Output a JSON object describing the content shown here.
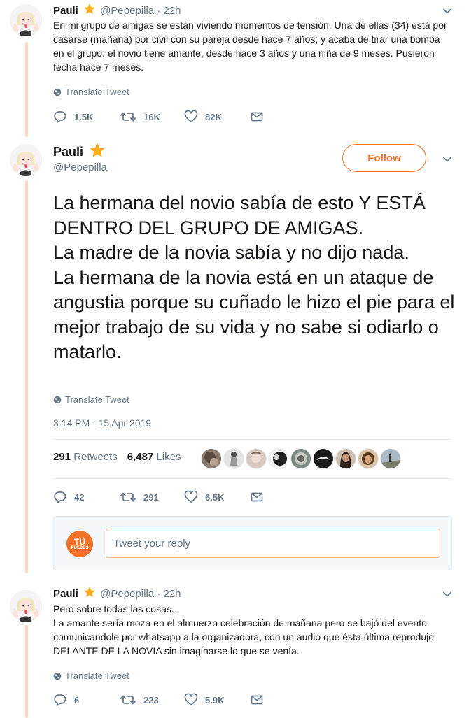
{
  "colors": {
    "accent": "#f0722a",
    "thread_line": "#ffd9c2",
    "star": "#ffad1f",
    "muted": "#657786",
    "text": "#14171a"
  },
  "tweet1": {
    "name": "Pauli",
    "handle_time": "@Pepepilla · 22h",
    "text": "En mi grupo de amigas se están viviendo momentos de tensión. Una de ellas (34) está por casarse (mañana) por civil con su pareja desde hace 7 años; y acaba de tirar una bomba en el grupo: el novio tiene amante, desde hace 3 años y una niña de 9 meses. Pusieron fecha hace 7 meses.",
    "translate": "Translate Tweet",
    "replies": "1.5K",
    "retweets": "16K",
    "likes": "82K"
  },
  "main_tweet": {
    "name": "Pauli",
    "handle": "@Pepepilla",
    "follow_label": "Follow",
    "text": "La hermana del novio sabía de esto Y ESTÁ DENTRO DEL GRUPO DE AMIGAS.\nLa madre de la novia sabía y no dijo nada.\nLa hermana de la novia está en un ataque de angustia porque su cuñado le hizo el pie para el mejor trabajo de su vida y no sabe si odiarlo o matarlo.",
    "translate": "Translate Tweet",
    "timestamp": "3:14 PM - 15 Apr 2019",
    "retweet_count": "291",
    "retweet_label": "Retweets",
    "like_count": "6,487",
    "like_label": "Likes",
    "replies": "42",
    "retweets": "291",
    "likes": "6.5K"
  },
  "reply_box": {
    "avatar_text": "TÚ",
    "avatar_sub": "PUEDES",
    "placeholder": "Tweet your reply"
  },
  "tweet3": {
    "name": "Pauli",
    "handle_time": "@Pepepilla · 22h",
    "text": "Pero sobre todas las cosas...\nLa amante sería moza en el almuerzo celebración de mañana pero se bajó del evento comunicandole por whatsapp a la organizadora, con un audio que ésta última reprodujo DELANTE DE LA NOVIA sin imaginarse lo que se venía.",
    "translate": "Translate Tweet",
    "replies": "6",
    "retweets": "223",
    "likes": "5.9K"
  },
  "icons": {
    "star": "star-icon",
    "chevron": "chevron-down-icon",
    "globe": "globe-icon",
    "reply": "reply-icon",
    "retweet": "retweet-icon",
    "like": "heart-icon",
    "dm": "envelope-icon"
  }
}
